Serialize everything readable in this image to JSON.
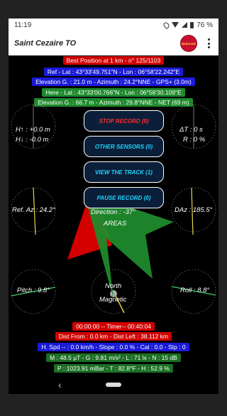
{
  "status": {
    "time": "11:19",
    "battery": "76 %"
  },
  "app": {
    "title": "Saint Cezaire TO",
    "logo_text": "Nationale"
  },
  "info": {
    "best": "Best Position at 1 km - n° 125/1103",
    "ref": "Ref - Lat : 43°33'49.751\"N - Lon : 06°58'22.242\"E",
    "ref_elev": "Elevation G. : 21.0 m - Azimuth : 24.2°NNE - GPS+ (3.0m)",
    "here": "Here - Lat : 43°33'00.766\"N - Lon : 06°58'30.109\"E",
    "here_elev": "Elevation G. : 66.7 m - Azimuth : 29.8°NNE - NET (69 m)",
    "timer": "00:00:00 -- Timer-- 00:40:04",
    "dist": "Dist From : 0.0 km - Dist Left : 38.112 km",
    "speed": "H. Spd -- : 0.0 km/h - Slope : 0.0 % - Cal : 0.0 - Stp : 0",
    "mag": "M : 48.5 µT - G : 9.81 m/s² - L : 71 lx - N : 15 dB",
    "press": "P : 1023.91 mBar - T : 82.8°F - H : 52.9 %"
  },
  "buttons": {
    "stop": "STOP RECORD (8)",
    "sensors": "OTHER SENSORS (0)",
    "track": "VIEW THE TRACK (1)",
    "pause": "PAUSE RECORD (0)"
  },
  "dials": {
    "h_up": "H↑ : +0.0 m",
    "h_down": "H↓ : -0.0 m",
    "dt": "ΔT : 0 s",
    "r": "R : 0 %",
    "ref_az": "Ref. Az : 24.2°",
    "daz": "DAz : 185.5°",
    "pitch": "Pitch : 9.8°",
    "roll": "Roll : 8.8°",
    "north": "North",
    "magnetic": "Magnetic"
  },
  "center": {
    "direction": "Direction : -37°",
    "areas": "AREAS"
  },
  "colors": {
    "red_bg": "#d10000",
    "blue_bg": "#1a1ad8",
    "green_bg": "#1f8a2c",
    "button_text_red": "#ff2b2b",
    "button_text_cyan": "#22d3ff"
  }
}
